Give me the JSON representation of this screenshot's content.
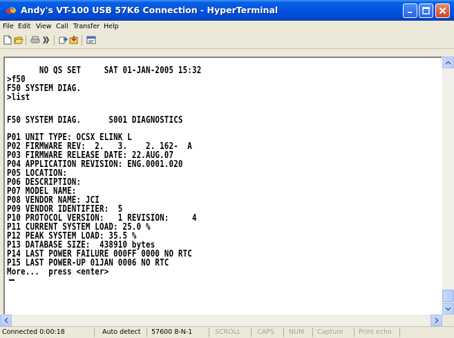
{
  "window": {
    "title": "Andy's VT-100 USB 57K6 Connection - HyperTerminal",
    "controls": [
      "minimize",
      "maximize",
      "close"
    ]
  },
  "menu": [
    "File",
    "Edit",
    "View",
    "Call",
    "Transfer",
    "Help"
  ],
  "toolbar": {
    "icons": [
      "new-icon",
      "open-icon",
      "disconnect-icon",
      "call-icon",
      "send-icon",
      "receive-icon",
      "properties-icon"
    ]
  },
  "terminal": {
    "lines": [
      "       NO QS SET     SAT 01-JAN-2005 15:32",
      ">f50",
      "F50 SYSTEM DIAG.",
      ">list",
      "",
      "F50 SYSTEM DIAG.      S001 DIAGNOSTICS",
      "",
      "P01 UNIT TYPE: OCSX ELINK L",
      "P02 FIRMWARE REV:  2.   3.    2. 162-  A",
      "P03 FIRMWARE RELEASE DATE: 22.AUG.07",
      "P04 APPLICATION REVISION: ENG.0001.020",
      "P05 LOCATION:",
      "P06 DESCRIPTION:",
      "P07 MODEL NAME:",
      "P08 VENDOR NAME: JCI",
      "P09 VENDOR IDENTIFIER:  5",
      "P10 PROTOCOL VERSION:   1 REVISION:     4",
      "P11 CURRENT SYSTEM LOAD: 25.0 %",
      "P12 PEAK SYSTEM LOAD: 35.5 %",
      "P13 DATABASE SIZE:  438910 bytes",
      "P14 LAST POWER FAILURE 000FF 0000 NO RTC",
      "P15 LAST POWER-UP 01JAN 0006 NO RTC",
      "More...  press <enter>"
    ]
  },
  "status": {
    "connected": "Connected 0:00:18",
    "detect": "Auto detect",
    "settings": "57600 8-N-1",
    "scroll": "SCROLL",
    "caps": "CAPS",
    "num": "NUM",
    "capture": "Capture",
    "print_echo": "Print echo"
  }
}
